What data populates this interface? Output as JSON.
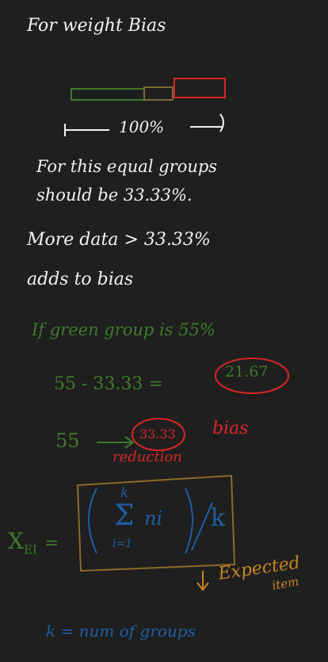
{
  "notes": {
    "title": "For weight Bias",
    "scale_label": "100%",
    "line1": "For this equal groups",
    "line2": "should be 33.33%.",
    "line3": "More data > 33.33%",
    "line4": "adds to bias",
    "green_text": "If green group is 55%",
    "calc_lhs": "55 - 33.33 =",
    "calc_result": "21.67",
    "reduction_lhs": "55",
    "reduction_value": "33.33",
    "bias_label": "bias",
    "reduction_label": "reduction",
    "formula_lhs": "X",
    "formula_sub": "EI",
    "formula_eq": "=",
    "sum_upper": "k",
    "sum_lower": "i=1",
    "sum_term": "ni",
    "divisor": "k",
    "expected_label": "Expected",
    "item_label": "item",
    "k_definition": "k = num of groups"
  },
  "colors": {
    "background": "#1f1f1f",
    "white_ink": "#f2f2f2",
    "green_ink": "#3f7a2a",
    "red_ink": "#d92525",
    "orange_ink": "#c9861e",
    "blue_ink": "#1f5fa6"
  }
}
